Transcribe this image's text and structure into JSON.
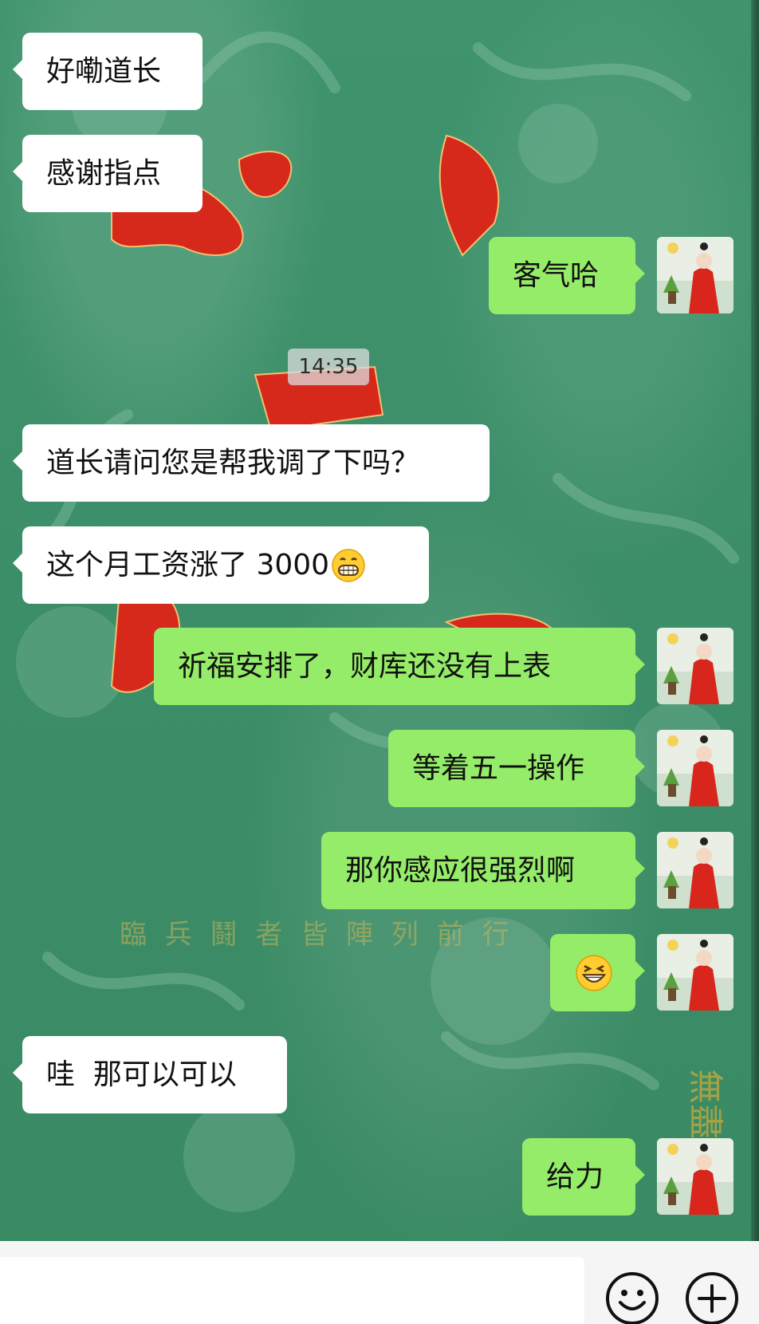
{
  "timestamp": "14:35",
  "messages": [
    {
      "side": "left",
      "text": "好嘞道长"
    },
    {
      "side": "left",
      "text": "感谢指点"
    },
    {
      "side": "right",
      "text": "客气哈"
    },
    {
      "side": "left",
      "text": "道长请问您是帮我调了下吗？"
    },
    {
      "side": "left",
      "text": "这个月工资涨了 3000",
      "emoji": "grinning-face-with-teeth"
    },
    {
      "side": "right",
      "text": "祈福安排了，财库还没有上表"
    },
    {
      "side": "right",
      "text": "等着五一操作"
    },
    {
      "side": "right",
      "text": "那你感应很强烈啊"
    },
    {
      "side": "right",
      "text": "",
      "emoji": "grinning-squinting-face"
    },
    {
      "side": "left",
      "text": "哇  那可以可以"
    },
    {
      "side": "right",
      "text": "给力"
    }
  ],
  "wallpaper_text": "臨 兵 鬪 者 皆 陣 列 前 行",
  "wallpaper_signature": "無盡",
  "input_bar": {
    "input_value": "",
    "emoji_button_icon": "smiley-icon",
    "more_button_icon": "plus-circle-icon"
  },
  "colors": {
    "background": "#3f8f6a",
    "left_bubble": "#ffffff",
    "right_bubble": "#95ec69",
    "input_bar": "#f5f5f5"
  }
}
